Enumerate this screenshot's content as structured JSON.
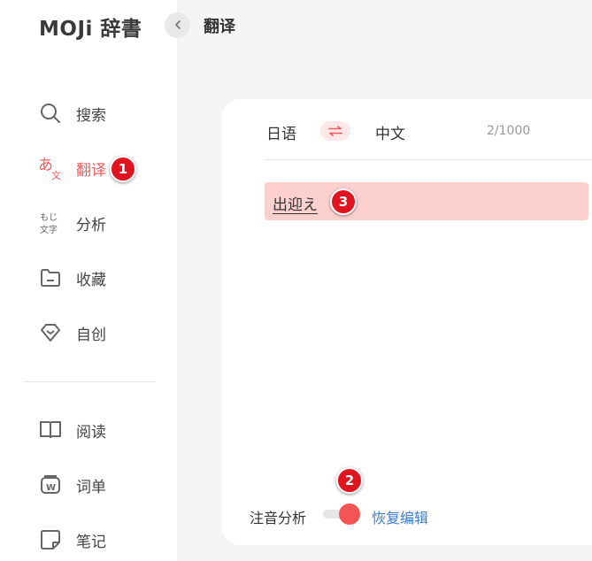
{
  "app": {
    "name": "MOJi 辞書"
  },
  "header": {
    "title": "翻译"
  },
  "sidebar": {
    "items": [
      {
        "label": "搜索",
        "icon": "search-icon"
      },
      {
        "label": "翻译",
        "icon": "translate-icon",
        "active": true
      },
      {
        "label": "分析",
        "icon": "analysis-icon",
        "icon_text_top": "もじ",
        "icon_text_bottom": "文字"
      },
      {
        "label": "收藏",
        "icon": "folder-icon"
      },
      {
        "label": "自创",
        "icon": "diamond-icon"
      },
      {
        "label": "阅读",
        "icon": "book-icon"
      },
      {
        "label": "词单",
        "icon": "word-list-icon",
        "icon_text": "W"
      },
      {
        "label": "笔记",
        "icon": "note-icon"
      }
    ]
  },
  "translator": {
    "source_lang": "日语",
    "target_lang": "中文",
    "char_count": "2/1000",
    "input_text": "出迎え"
  },
  "footer": {
    "phonetic_label": "注音分析",
    "toggle_on": true,
    "restore_label": "恢复编辑"
  },
  "annotations": {
    "badge1": "1",
    "badge2": "2",
    "badge3": "3"
  },
  "colors": {
    "accent": "#f25a5a",
    "link": "#3d7fd0",
    "highlight": "#fdd0d0",
    "badge": "#e0141e"
  }
}
